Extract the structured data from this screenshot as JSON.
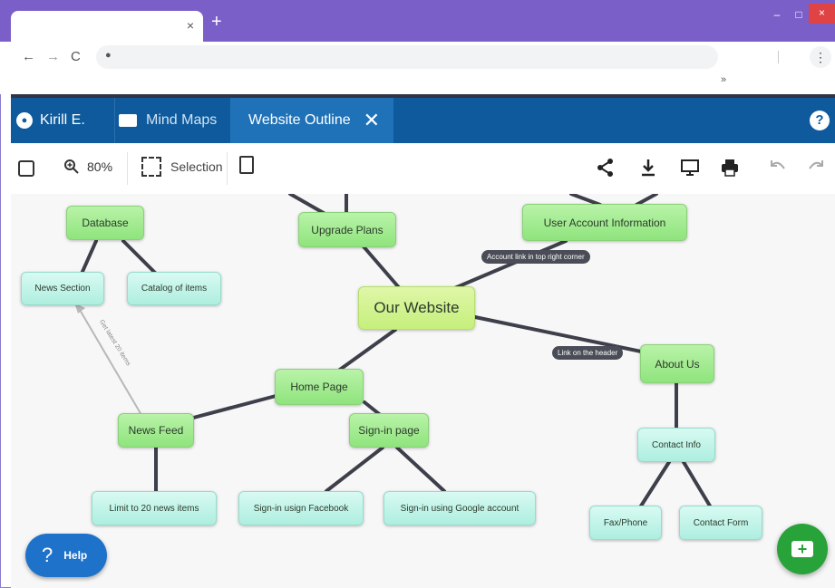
{
  "browser": {
    "tab_close": "×",
    "new_tab": "+",
    "win_min": "–",
    "win_max": "□",
    "win_close": "×",
    "back": "←",
    "forward": "→",
    "reload": "C",
    "menu": "⋮",
    "overflow": "»"
  },
  "header": {
    "user": "Kirill E.",
    "maps": "Mind Maps",
    "active_tab": "Website Outline",
    "tab_close": "✕",
    "help": "?"
  },
  "toolbar": {
    "zoom": "80%",
    "selection": "Selection"
  },
  "mindmap": {
    "center": "Our Website",
    "nodes": {
      "database": "Database",
      "news_section": "News Section",
      "catalog": "Catalog of items",
      "upgrade_plans": "Upgrade Plans",
      "user_account": "User Account Information",
      "about_us": "About Us",
      "contact_info": "Contact Info",
      "fax_phone": "Fax/Phone",
      "contact_form": "Contact Form",
      "home_page": "Home Page",
      "news_feed": "News Feed",
      "limit_news": "Limit to 20 news items",
      "signin_page": "Sign-in page",
      "signin_facebook": "Sign-in usign Facebook",
      "signin_google": "Sign-in using Google account"
    },
    "labels": {
      "account_link": "Account link in top right corner",
      "link_header": "Link on the header",
      "arrow_text": "Get latest 20 items"
    }
  },
  "help_button": "Help",
  "colors": {
    "titlebar": "#7b5fc9",
    "appbar": "#0e5a9c",
    "node_green": "#9fe88c",
    "node_teal": "#c2f4e9",
    "add_button": "#27a33a",
    "help_button": "#1f72c9"
  }
}
